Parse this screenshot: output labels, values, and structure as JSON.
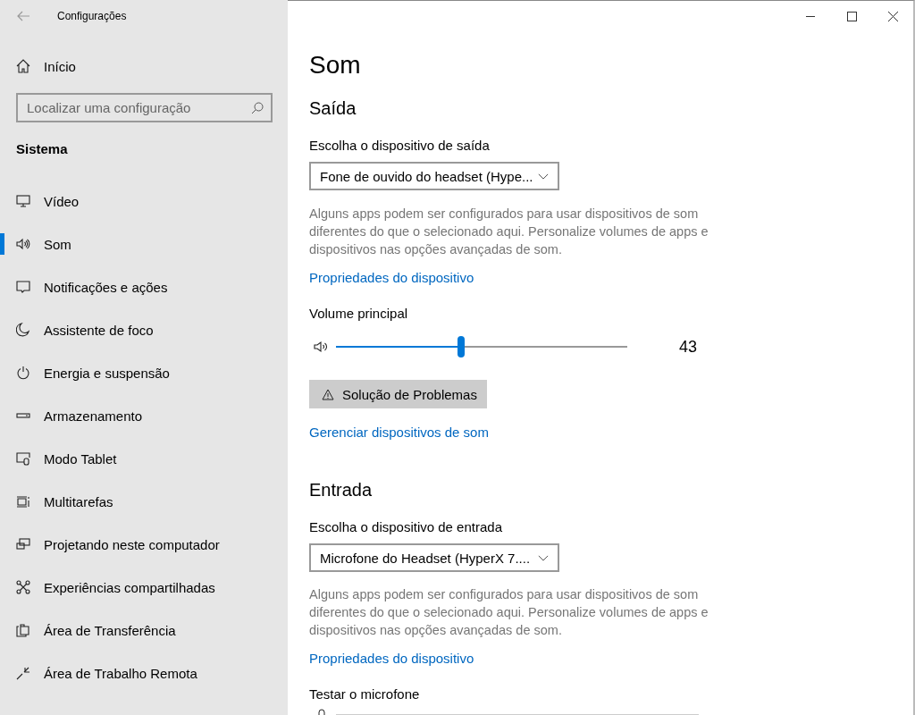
{
  "window": {
    "title": "Configurações"
  },
  "sidebar": {
    "home": "Início",
    "search": {
      "placeholder": "Localizar uma configuração"
    },
    "section": "Sistema",
    "items": [
      {
        "label": "Vídeo",
        "selected": false
      },
      {
        "label": "Som",
        "selected": true
      },
      {
        "label": "Notificações e ações",
        "selected": false
      },
      {
        "label": "Assistente de foco",
        "selected": false
      },
      {
        "label": "Energia e suspensão",
        "selected": false
      },
      {
        "label": "Armazenamento",
        "selected": false
      },
      {
        "label": "Modo Tablet",
        "selected": false
      },
      {
        "label": "Multitarefas",
        "selected": false
      },
      {
        "label": "Projetando neste computador",
        "selected": false
      },
      {
        "label": "Experiências compartilhadas",
        "selected": false
      },
      {
        "label": "Área de Transferência",
        "selected": false
      },
      {
        "label": "Área de Trabalho Remota",
        "selected": false
      }
    ]
  },
  "content": {
    "title": "Som",
    "output": {
      "heading": "Saída",
      "device_label": "Escolha o dispositivo de saída",
      "device": "Fone de ouvido do headset (Hype...",
      "note": "Alguns apps podem ser configurados para usar dispositivos de som diferentes do que o selecionado aqui. Personalize volumes de apps e dispositivos nas opções avançadas de som.",
      "properties_link": "Propriedades do dispositivo",
      "volume_label": "Volume principal",
      "volume": {
        "level": 0.43,
        "reading": "43"
      },
      "troubleshoot_button": "Solução de Problemas",
      "manage_link": "Gerenciar dispositivos de som"
    },
    "input": {
      "heading": "Entrada",
      "device_label": "Escolha o dispositivo de entrada",
      "device": "Microfone do Headset (HyperX 7....",
      "note": "Alguns apps podem ser configurados para usar dispositivos de som diferentes do que o selecionado aqui. Personalize volumes de apps e dispositivos nas opções avançadas de som.",
      "properties_link": "Propriedades do dispositivo",
      "test_label": "Testar o microfone"
    }
  }
}
